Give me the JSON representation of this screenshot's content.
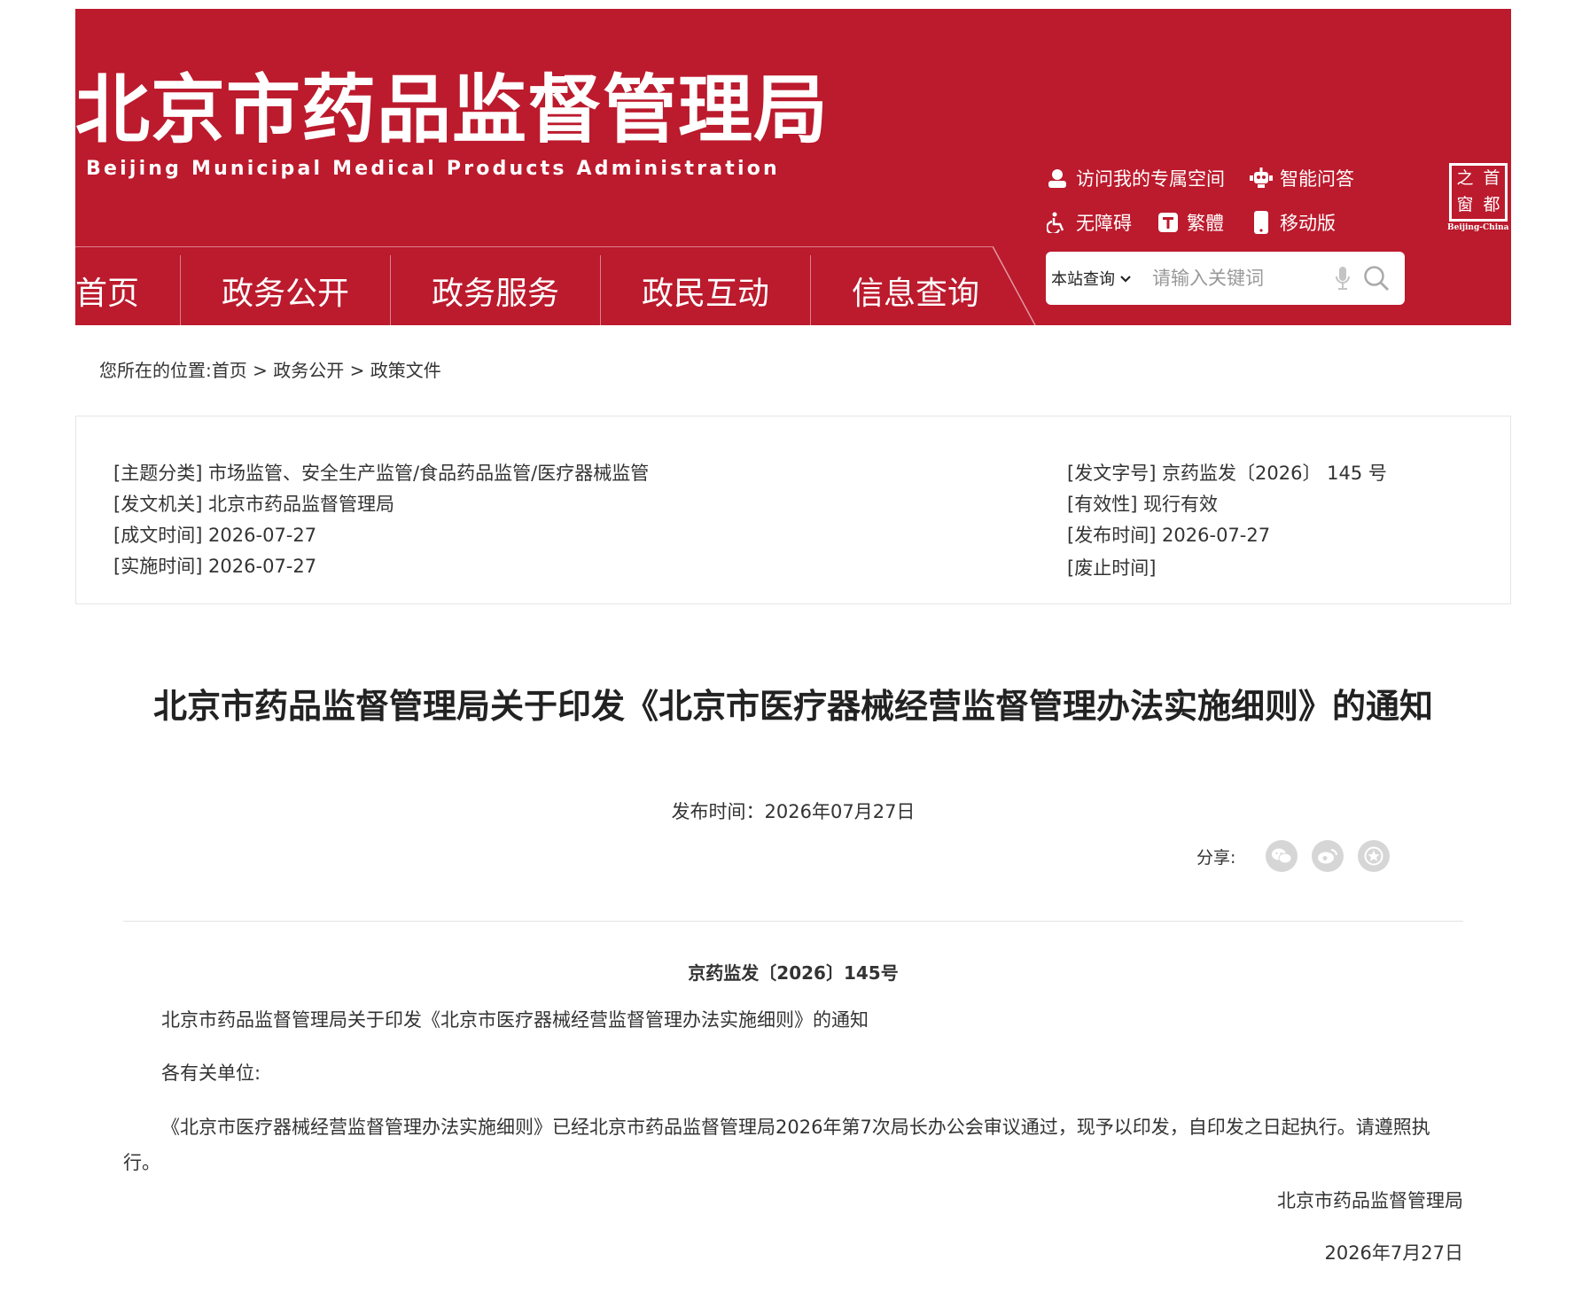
{
  "header": {
    "logo_cn": "北京市药品监督管理局",
    "logo_en": "Beijing Municipal Medical Products Administration",
    "links": {
      "my_space": "访问我的专属空间",
      "smart_qa": "智能问答",
      "accessibility": "无障碍",
      "traditional": "繁體",
      "mobile": "移动版"
    },
    "seal": {
      "chars": [
        "之",
        "首",
        "窗",
        "都"
      ],
      "sub": "Beijing-China"
    },
    "colors": {
      "brand_red": "#bc1a2d"
    }
  },
  "nav": {
    "home": "首页",
    "gov_open": "政务公开",
    "gov_service": "政务服务",
    "interaction": "政民互动",
    "info_query": "信息查询"
  },
  "search": {
    "scope": "本站查询",
    "placeholder": "请输入关键词"
  },
  "breadcrumb": {
    "prefix": "您所在的位置:",
    "home": "首页",
    "sep": ">",
    "level1": "政务公开",
    "level2": "政策文件"
  },
  "meta": {
    "topic": "[主题分类] 市场监管、安全生产监管/食品药品监管/医疗器械监管",
    "issuer": "[发文机关] 北京市药品监督管理局",
    "created": "[成文时间] 2026-07-27",
    "effective": "[实施时间] 2026-07-27",
    "doc_number": "[发文字号] 京药监发〔2026〕 145 号",
    "validity": "[有效性] 现行有效",
    "published": "[发布时间] 2026-07-27",
    "repealed": "[废止时间]"
  },
  "article": {
    "title": "北京市药品监督管理局关于印发《北京市医疗器械经营监督管理办法实施细则》的通知",
    "pubdate": "发布时间：2026年07月27日",
    "share_label": "分享:",
    "doc_no": "京药监发〔2026〕145号",
    "subtitle": "北京市药品监督管理局关于印发《北京市医疗器械经营监督管理办法实施细则》的通知",
    "salutation": "各有关单位:",
    "body": "《北京市医疗器械经营监督管理办法实施细则》已经北京市药品监督管理局2026年第7次局长办公会审议通过，现予以印发，自印发之日起执行。请遵照执行。",
    "signature": "北京市药品监督管理局",
    "sign_date": "2026年7月27日"
  },
  "icons": [
    "user-icon",
    "robot-icon",
    "wheelchair-icon",
    "text-t-icon",
    "mobile-icon",
    "chevron-down-icon",
    "microphone-icon",
    "search-icon",
    "wechat-icon",
    "weibo-icon",
    "star-icon"
  ]
}
